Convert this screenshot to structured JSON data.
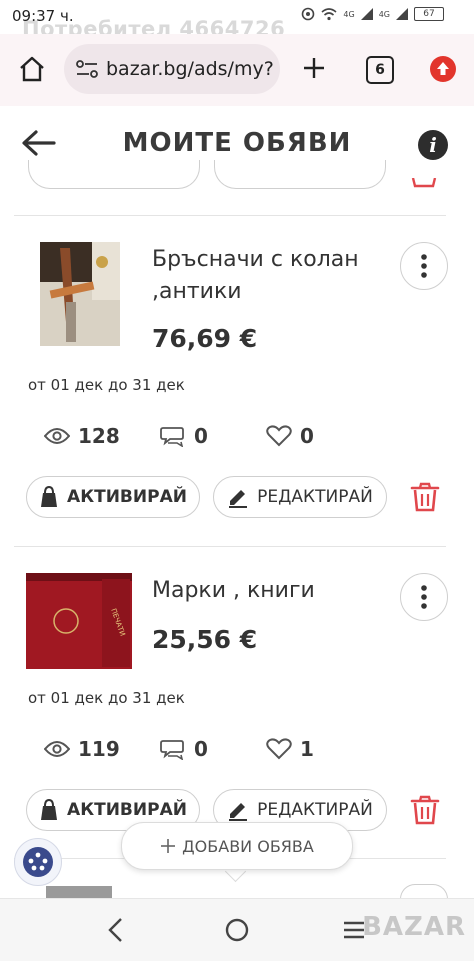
{
  "status": {
    "time": "09:37 ч.",
    "ghost_user": "Потребител 4664726",
    "net1": "4G",
    "net2": "4G",
    "battery": "67"
  },
  "browser": {
    "url": "bazar.bg/ads/my?",
    "tabs_count": "6"
  },
  "header": {
    "title": "МОИТЕ ОБЯВИ"
  },
  "listings": [
    {
      "title": "Бръсначи с колан ,антики",
      "price": "76,69 €",
      "period": "от 01 дек до 31 дек",
      "views": "128",
      "messages": "0",
      "favorites": "0",
      "activate_label": "АКТИВИРАЙ",
      "edit_label": "РЕДАКТИРАЙ"
    },
    {
      "title": "Марки , книги",
      "price": "25,56 €",
      "period": "от 01 дек до 31 дек",
      "views": "119",
      "messages": "0",
      "favorites": "1",
      "activate_label": "АКТИВИРАЙ",
      "edit_label": "РЕДАКТИРАЙ"
    }
  ],
  "add_button_label": "ДОБАВИ ОБЯВА",
  "colors": {
    "accent_red": "#e0474c",
    "browser_bg": "#fbf4f6",
    "upload_red": "#e2352c"
  },
  "watermark": "BAZAR"
}
